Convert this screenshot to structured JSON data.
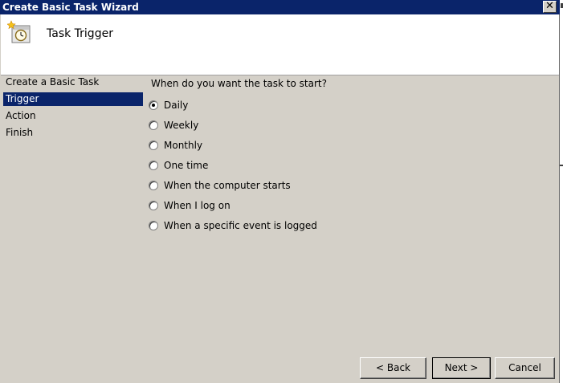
{
  "window": {
    "title": "Create Basic Task Wizard",
    "close_label": "✕"
  },
  "header": {
    "title": "Task Trigger",
    "icon": "task-scheduler-clock-icon"
  },
  "nav": {
    "items": [
      {
        "label": "Create a Basic Task",
        "selected": false
      },
      {
        "label": "Trigger",
        "selected": true
      },
      {
        "label": "Action",
        "selected": false
      },
      {
        "label": "Finish",
        "selected": false
      }
    ]
  },
  "content": {
    "question": "When do you want the task to start?",
    "options": [
      {
        "label": "Daily",
        "checked": true
      },
      {
        "label": "Weekly",
        "checked": false
      },
      {
        "label": "Monthly",
        "checked": false
      },
      {
        "label": "One time",
        "checked": false
      },
      {
        "label": "When the computer starts",
        "checked": false
      },
      {
        "label": "When I log on",
        "checked": false
      },
      {
        "label": "When a specific event is logged",
        "checked": false
      }
    ]
  },
  "buttons": {
    "back": "< Back",
    "next": "Next >",
    "cancel": "Cancel"
  },
  "colors": {
    "titlebar": "#0a246a",
    "window_bg": "#d4d0c8",
    "selection": "#0a246a"
  }
}
